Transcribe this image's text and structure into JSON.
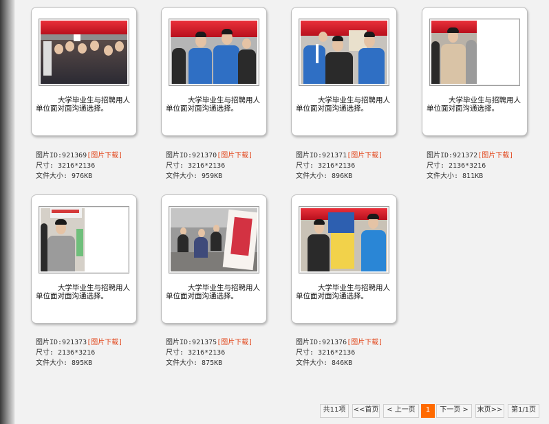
{
  "cards": [
    {
      "caption": "大学毕业生与招聘用人单位面对面沟通选择。",
      "id_label": "图片ID:921369",
      "download": "[图片下载]",
      "size": "尺寸: 3216*2136",
      "file_size": "文件大小: 976KB"
    },
    {
      "caption": "大学毕业生与招聘用人单位面对面沟通选择。",
      "id_label": "图片ID:921370",
      "download": "[图片下载]",
      "size": "尺寸: 3216*2136",
      "file_size": "文件大小: 959KB"
    },
    {
      "caption": "大学毕业生与招聘用人单位面对面沟通选择。",
      "id_label": "图片ID:921371",
      "download": "[图片下载]",
      "size": "尺寸: 3216*2136",
      "file_size": "文件大小: 896KB"
    },
    {
      "caption": "大学毕业生与招聘用人单位面对面沟通选择。",
      "id_label": "图片ID:921372",
      "download": "[图片下载]",
      "size": "尺寸: 2136*3216",
      "file_size": "文件大小: 811KB"
    },
    {
      "caption": "大学毕业生与招聘用人单位面对面沟通选择。",
      "id_label": "图片ID:921373",
      "download": "[图片下载]",
      "size": "尺寸: 2136*3216",
      "file_size": "文件大小: 895KB"
    },
    {
      "caption": "大学毕业生与招聘用人单位面对面沟通选择。",
      "id_label": "图片ID:921375",
      "download": "[图片下载]",
      "size": "尺寸: 3216*2136",
      "file_size": "文件大小: 875KB"
    },
    {
      "caption": "大学毕业生与招聘用人单位面对面沟通选择。",
      "id_label": "图片ID:921376",
      "download": "[图片下载]",
      "size": "尺寸: 3216*2136",
      "file_size": "文件大小: 846KB"
    }
  ],
  "pagination": {
    "total": "共11项",
    "first": "<<首页",
    "prev": "< 上一页",
    "current": "1",
    "next": "下一页 >",
    "last": "末页>>",
    "page_info": "第1/1页"
  },
  "colors": {
    "accent": "#ff6a00",
    "download_link": "#e2471c"
  }
}
